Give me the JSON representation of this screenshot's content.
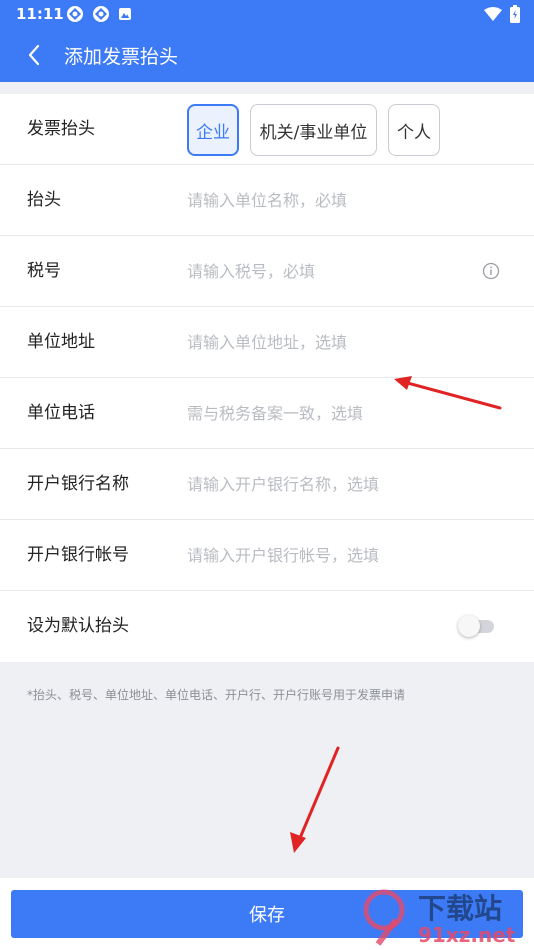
{
  "status_bar": {
    "time": "11:11"
  },
  "header": {
    "title": "添加发票抬头"
  },
  "form": {
    "invoice_type": {
      "label": "发票抬头",
      "options": [
        "企业",
        "机关/事业单位",
        "个人"
      ],
      "selected": "企业"
    },
    "title": {
      "label": "抬头",
      "placeholder": "请输入单位名称，必填",
      "value": ""
    },
    "tax_id": {
      "label": "税号",
      "placeholder": "请输入税号，必填",
      "value": ""
    },
    "address": {
      "label": "单位地址",
      "placeholder": "请输入单位地址，选填",
      "value": ""
    },
    "phone": {
      "label": "单位电话",
      "placeholder": "需与税务备案一致，选填",
      "value": ""
    },
    "bank_name": {
      "label": "开户银行名称",
      "placeholder": "请输入开户银行名称，选填",
      "value": ""
    },
    "bank_account": {
      "label": "开户银行帐号",
      "placeholder": "请输入开户银行帐号，选填",
      "value": ""
    },
    "default": {
      "label": "设为默认抬头",
      "enabled": false
    }
  },
  "note": "*抬头、税号、单位地址、单位电话、开户行、开户行账号用于发票申请",
  "save_label": "保存",
  "watermark": {
    "text": "91xz.net",
    "brand": "下载站"
  },
  "colors": {
    "primary": "#3d7bf6",
    "annotation_arrow": "#e02424"
  },
  "icons": [
    "settings-icon",
    "settings-icon",
    "image-icon",
    "wifi-icon",
    "battery-icon",
    "back-arrow-icon",
    "info-icon",
    "toggle-switch"
  ]
}
